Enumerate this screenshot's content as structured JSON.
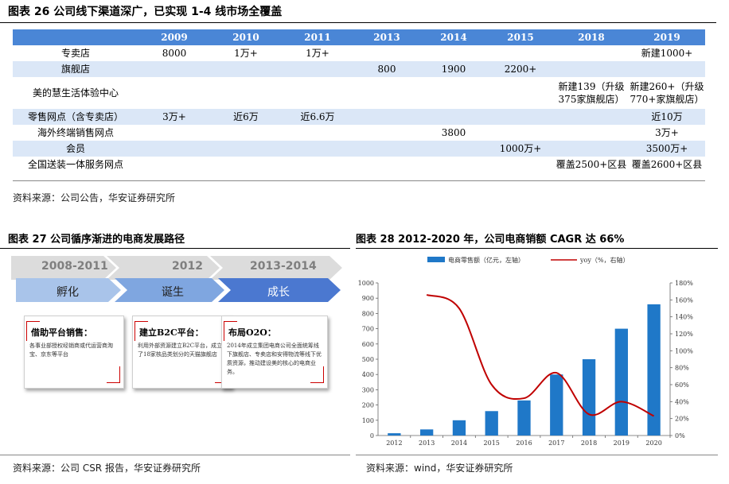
{
  "table_section": {
    "title": "图表 26 公司线下渠道深广，已实现 1-4 线市场全覆盖",
    "headers": [
      "",
      "2009",
      "2010",
      "2011",
      "2013",
      "2014",
      "2015",
      "2018",
      "2019"
    ],
    "rows": [
      [
        "专卖店",
        "8000",
        "1万+",
        "1万+",
        "",
        "",
        "",
        "",
        "新建1000+"
      ],
      [
        "旗舰店",
        "",
        "",
        "",
        "800",
        "1900",
        "2200+",
        "",
        ""
      ],
      [
        "美的慧生活体验中心",
        "",
        "",
        "",
        "",
        "",
        "",
        "新建139（升级375家旗舰店）",
        "新建260+（升级770+家旗舰店）"
      ],
      [
        "零售网点（含专卖店）",
        "3万+",
        "近6万",
        "近6.6万",
        "",
        "",
        "",
        "",
        "近10万"
      ],
      [
        "海外终端销售网点",
        "",
        "",
        "",
        "",
        "3800",
        "",
        "",
        "3万+"
      ],
      [
        "会员",
        "",
        "",
        "",
        "",
        "",
        "1000万+",
        "",
        "3500万+"
      ],
      [
        "全国送装一体服务网点",
        "",
        "",
        "",
        "",
        "",
        "",
        "覆盖2500+区县",
        "覆盖2600+区县"
      ]
    ],
    "source": "资料来源：公司公告，华安证券研究所"
  },
  "path_section": {
    "title": "图表 27 公司循序渐进的电商发展路径",
    "stages": [
      {
        "year": "2008-2011",
        "label": "孵化",
        "card_title": "借助平台销售：",
        "card_body": "各事业部授权经销商或代运营商淘宝、京东等平台"
      },
      {
        "year": "2012",
        "label": "诞生",
        "card_title": "建立B2C平台：",
        "card_body": "利用外部资源建立B2C平台，成立了18家核品类划分的天猫旗舰店"
      },
      {
        "year": "2013-2014",
        "label": "成长",
        "card_title": "布局O2O：",
        "card_body": "2014年成立集团电商公司全面统筹线下旗舰店、专卖店和安得物流等线下优质资源，推动建设美的核心的电商业务。"
      }
    ],
    "source": "资料来源：公司 CSR 报告，华安证券研究所"
  },
  "chart_section": {
    "title": "图表 28 2012-2020 年，公司电商销额 CAGR 达 66%",
    "source": "资料来源：wind，华安证券研究所",
    "y_ticks": [
      "0",
      "100",
      "200",
      "300",
      "400",
      "500",
      "600",
      "700",
      "800",
      "900",
      "1000"
    ],
    "y2_ticks": [
      "0%",
      "20%",
      "40%",
      "60%",
      "80%",
      "100%",
      "120%",
      "140%",
      "160%",
      "180%"
    ]
  },
  "chart_data": {
    "type": "bar",
    "categories": [
      "2012",
      "2013",
      "2014",
      "2015",
      "2016",
      "2017",
      "2018",
      "2019",
      "2020"
    ],
    "series": [
      {
        "name": "电商零售额（亿元，左轴）",
        "type": "bar",
        "axis": "left",
        "values": [
          15,
          40,
          100,
          160,
          230,
          400,
          500,
          700,
          860
        ]
      },
      {
        "name": "yoy（%，右轴）",
        "type": "line",
        "axis": "right",
        "values": [
          null,
          1.66,
          1.5,
          0.6,
          0.44,
          0.74,
          0.25,
          0.4,
          0.23
        ]
      }
    ],
    "ylim": [
      0,
      1000
    ],
    "y2lim": [
      0,
      1.8
    ],
    "bar_color": "#1f78c8",
    "line_color": "#c00000",
    "legend_position": "top"
  }
}
